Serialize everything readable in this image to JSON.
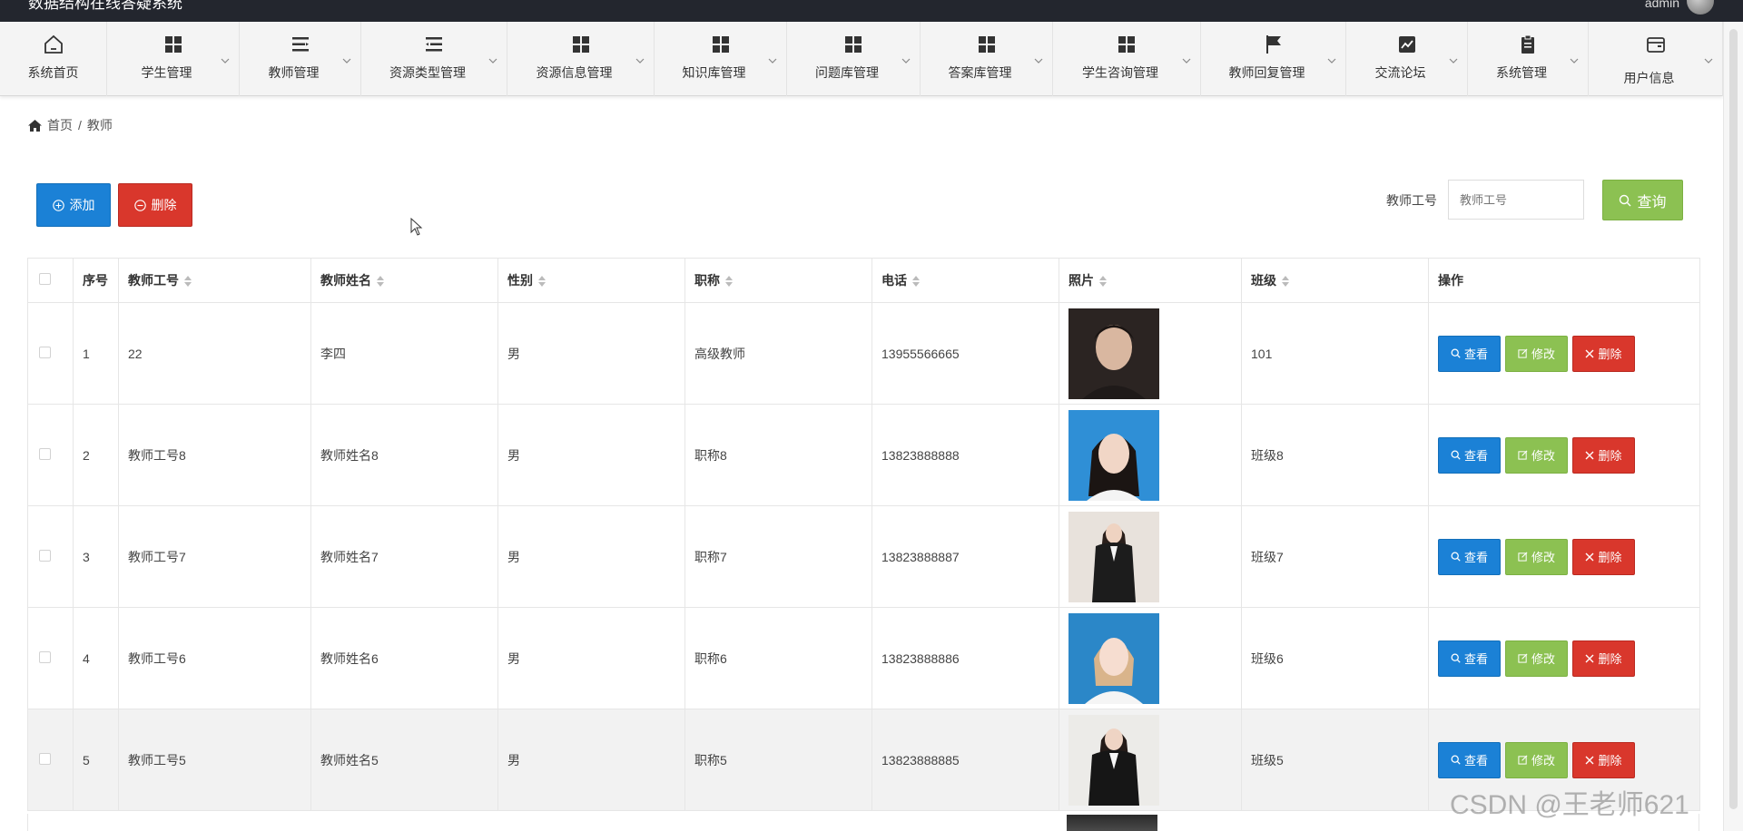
{
  "app": {
    "title": "数据结构在线答疑系统",
    "user": "admin"
  },
  "nav": [
    {
      "label": "系统首页",
      "icon": "home-icon"
    },
    {
      "label": "学生管理",
      "icon": "grid-icon"
    },
    {
      "label": "教师管理",
      "icon": "list-icon"
    },
    {
      "label": "资源类型管理",
      "icon": "list-indent-icon"
    },
    {
      "label": "资源信息管理",
      "icon": "grid-icon"
    },
    {
      "label": "知识库管理",
      "icon": "grid-icon"
    },
    {
      "label": "问题库管理",
      "icon": "grid-icon"
    },
    {
      "label": "答案库管理",
      "icon": "grid-icon"
    },
    {
      "label": "学生咨询管理",
      "icon": "grid-icon"
    },
    {
      "label": "教师回复管理",
      "icon": "flag-icon"
    },
    {
      "label": "交流论坛",
      "icon": "chart-icon"
    },
    {
      "label": "系统管理",
      "icon": "clipboard-icon"
    },
    {
      "label": "用户信息",
      "icon": "wallet-icon"
    }
  ],
  "breadcrumb": {
    "home": "首页",
    "separator": "/",
    "current": "教师"
  },
  "toolbar": {
    "add_label": "添加",
    "delete_label": "删除"
  },
  "search": {
    "label": "教师工号",
    "placeholder": "教师工号",
    "button_label": "查询"
  },
  "table": {
    "headers": [
      "序号",
      "教师工号",
      "教师姓名",
      "性别",
      "职称",
      "电话",
      "照片",
      "班级",
      "操作"
    ],
    "rows": [
      {
        "index": "1",
        "id": "22",
        "name": "李四",
        "gender": "男",
        "title": "高级教师",
        "phone": "13955566665",
        "class": "101",
        "photo": "photo-man"
      },
      {
        "index": "2",
        "id": "教师工号8",
        "name": "教师姓名8",
        "gender": "男",
        "title": "职称8",
        "phone": "13823888888",
        "class": "班级8",
        "photo": "photo-woman-blue"
      },
      {
        "index": "3",
        "id": "教师工号7",
        "name": "教师姓名7",
        "gender": "男",
        "title": "职称7",
        "phone": "13823888887",
        "class": "班级7",
        "photo": "photo-woman-suit"
      },
      {
        "index": "4",
        "id": "教师工号6",
        "name": "教师姓名6",
        "gender": "男",
        "title": "职称6",
        "phone": "13823888886",
        "class": "班级6",
        "photo": "photo-woman-blue2"
      },
      {
        "index": "5",
        "id": "教师工号5",
        "name": "教师姓名5",
        "gender": "男",
        "title": "职称5",
        "phone": "13823888885",
        "class": "班级5",
        "photo": "photo-woman-suit2"
      }
    ],
    "actions": {
      "view": "查看",
      "edit": "修改",
      "delete": "删除"
    }
  },
  "watermark": "CSDN @王老师621",
  "colors": {
    "primary": "#1b81d6",
    "success": "#8cc152",
    "danger": "#d9372c",
    "topbar": "#23262e"
  }
}
